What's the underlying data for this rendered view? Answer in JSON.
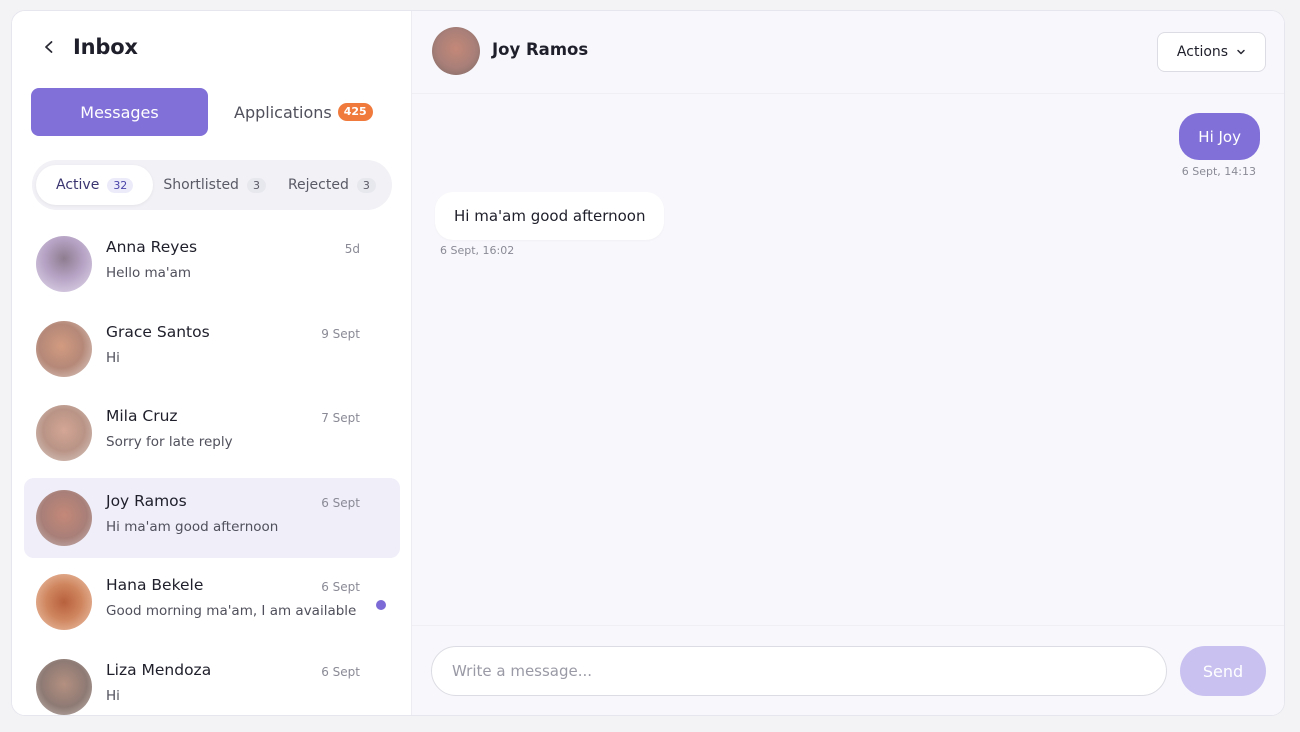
{
  "sidebar": {
    "title": "Inbox",
    "tabs": {
      "messages_label": "Messages",
      "applications_label": "Applications",
      "applications_count": "425"
    },
    "filters": [
      {
        "label": "Active",
        "count": "32"
      },
      {
        "label": "Shortlisted",
        "count": "3"
      },
      {
        "label": "Rejected",
        "count": "3"
      }
    ],
    "conversations": [
      {
        "name": "Anna Reyes",
        "preview": "Hello ma'am",
        "time": "5d",
        "avatar_color": "#b6a2c4"
      },
      {
        "name": "Grace Santos",
        "preview": "Hi",
        "time": "9 Sept",
        "avatar_color": "#c59a86"
      },
      {
        "name": "Mila Cruz",
        "preview": "Sorry for late reply",
        "time": "7 Sept",
        "avatar_color": "#c2a397"
      },
      {
        "name": "Joy Ramos",
        "preview": "Hi ma'am good afternoon",
        "time": "6 Sept",
        "avatar_color": "#b48679"
      },
      {
        "name": "Hana Bekele",
        "preview": "Good morning ma'am, I am available",
        "time": "6 Sept",
        "avatar_color": "#c77a57",
        "unread": true
      },
      {
        "name": "Liza Mendoza",
        "preview": "Hi",
        "time": "6 Sept",
        "avatar_color": "#a48c82"
      }
    ]
  },
  "chat": {
    "contact_name": "Joy Ramos",
    "actions_label": "Actions",
    "messages": [
      {
        "direction": "outgoing",
        "text": "Hi Joy",
        "time": "6 Sept, 14:13"
      },
      {
        "direction": "incoming",
        "text": "Hi ma'am good afternoon",
        "time": "6 Sept, 16:02"
      }
    ],
    "composer": {
      "placeholder": "Write a message...",
      "send_label": "Send"
    }
  },
  "colors": {
    "accent": "#8170d8",
    "accent_light": "#c9c2f0",
    "badge_orange": "#f07a3c",
    "selected_bg": "#efeef9",
    "unread_dot": "#7c6bd6"
  }
}
